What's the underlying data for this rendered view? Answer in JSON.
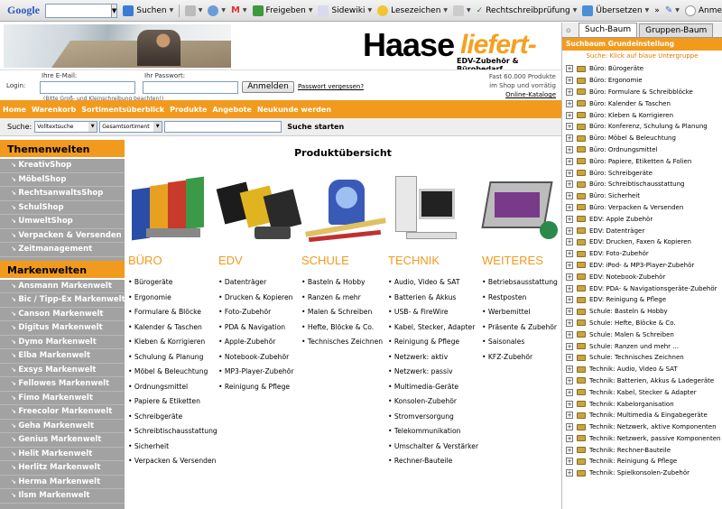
{
  "toolbar": {
    "logo": "Google",
    "search": "Suchen",
    "share": "Freigeben",
    "sidewiki": "Sidewiki",
    "bookmarks": "Lesezeichen",
    "spell": "Rechtschreibprüfung",
    "translate": "Übersetzen",
    "more": "»",
    "signin": "Anme"
  },
  "header": {
    "brand": "Haase",
    "brand2": "liefert-es",
    "tagline": "EDV-Zubehör & Bürobedarf"
  },
  "login": {
    "email_label": "Ihre E-Mail:",
    "password_label": "Ihr Passwort:",
    "login_label": "Login:",
    "button": "Anmelden",
    "forgot": "Passwort vergessen?",
    "hint": "(Bitte Groß- und Kleinschreibung beachten!)",
    "stock_line1": "Fast 60.000 Produkte",
    "stock_line2": "im Shop und vorrätig",
    "catalog": "Online-Kataloge"
  },
  "nav": [
    "Home",
    "Warenkorb",
    "Sortimentsüberblick",
    "Produkte",
    "Angebote",
    "Neukunde werden"
  ],
  "search": {
    "label": "Suche:",
    "type": "Volltextsuche",
    "scope": "Gesamtsortiment",
    "go": "Suche starten"
  },
  "themen": {
    "title": "Themenwelten",
    "items": [
      "KreativShop",
      "MöbelShop",
      "RechtsanwaltsShop",
      "SchulShop",
      "UmweltShop",
      "Verpacken & Versenden",
      "Zeitmanagement"
    ]
  },
  "marken": {
    "title": "Markenwelten",
    "items": [
      "Ansmann Markenwelt",
      "Bic / Tipp-Ex Markenwelt",
      "Canson Markenwelt",
      "Digitus Markenwelt",
      "Dymo Markenwelt",
      "Elba Markenwelt",
      "Exsys Markenwelt",
      "Fellowes Markenwelt",
      "Fimo Markenwelt",
      "Freecolor Markenwelt",
      "Geha Markenwelt",
      "Genius Markenwelt",
      "Helit Markenwelt",
      "Herlitz Markenwelt",
      "Herma Markenwelt",
      "Ilsm Markenwelt"
    ]
  },
  "content": {
    "title": "Produktübersicht"
  },
  "categories": [
    {
      "name": "BÜRO",
      "items": [
        "Bürogeräte",
        "Ergonomie",
        "Formulare & Blöcke",
        "Kalender & Taschen",
        "Kleben & Korrigieren",
        "Schulung & Planung",
        "Möbel & Beleuchtung",
        "Ordnungsmittel",
        "Papiere & Etiketten",
        "Schreibgeräte",
        "Schreibtischausstattung",
        "Sicherheit",
        "Verpacken & Versenden"
      ]
    },
    {
      "name": "EDV",
      "items": [
        "Datenträger",
        "Drucken & Kopieren",
        "Foto-Zubehör",
        "PDA & Navigation",
        "Apple-Zubehör",
        "Notebook-Zubehör",
        "MP3-Player-Zubehör",
        "Reinigung & Pflege"
      ]
    },
    {
      "name": "SCHULE",
      "items": [
        "Basteln & Hobby",
        "Ranzen & mehr",
        "Malen & Schreiben",
        "Hefte, Blöcke & Co.",
        "Technisches Zeichnen"
      ]
    },
    {
      "name": "TECHNIK",
      "items": [
        "Audio, Video & SAT",
        "Batterien & Akkus",
        "USB- & FireWire",
        "Kabel, Stecker, Adapter",
        "Reinigung & Pflege",
        "Netzwerk: aktiv",
        "Netzwerk: passiv",
        "Multimedia-Geräte",
        "Konsolen-Zubehör",
        "Stromversorgung",
        "Telekommunikation",
        "Umschalter & Verstärker",
        "Rechner-Bauteile"
      ]
    },
    {
      "name": "WEITERES",
      "items": [
        "Betriebsausstattung",
        "Restposten",
        "Werbemittel",
        "Präsente & Zubehör",
        "Saisonales",
        "KFZ-Zubehör"
      ]
    }
  ],
  "sidebar": {
    "tab1": "Such-Baum",
    "tab2": "Gruppen-Baum",
    "head": "Suchbaum Grundeinstellung",
    "hint": "Suche: Klick auf blaue Untergruppe",
    "items": [
      "Büro: Bürogeräte",
      "Büro: Ergonomie",
      "Büro: Formulare & Schreibblöcke",
      "Büro: Kalender & Taschen",
      "Büro: Kleben & Korrigieren",
      "Büro: Konferenz, Schulung & Planung",
      "Büro: Möbel & Beleuchtung",
      "Büro: Ordnungsmittel",
      "Büro: Papiere, Etiketten & Folien",
      "Büro: Schreibgeräte",
      "Büro: Schreibtischausstattung",
      "Büro: Sicherheit",
      "Büro: Verpacken & Versenden",
      "EDV: Apple Zubehör",
      "EDV: Datenträger",
      "EDV: Drucken, Faxen & Kopieren",
      "EDV: Foto-Zubehör",
      "EDV: iPod- & MP3-Player-Zubehör",
      "EDV: Notebook-Zubehör",
      "EDV: PDA- & Navigationsgeräte-Zubehör",
      "EDV: Reinigung & Pflege",
      "Schule: Basteln & Hobby",
      "Schule: Hefte, Blöcke & Co.",
      "Schule: Malen & Schreiben",
      "Schule: Ranzen und mehr ...",
      "Schule: Technisches Zeichnen",
      "Technik: Audio, Video & SAT",
      "Technik: Batterien, Akkus & Ladegeräte",
      "Technik: Kabel, Stecker & Adapter",
      "Technik: Kabelorganisation",
      "Technik: Multimedia & Eingabegeräte",
      "Technik: Netzwerk, aktive Komponenten",
      "Technik: Netzwerk, passive Komponenten",
      "Technik: Rechner-Bauteile",
      "Technik: Reinigung & Pflege",
      "Technik: Spielkonsolen-Zubehör"
    ]
  }
}
